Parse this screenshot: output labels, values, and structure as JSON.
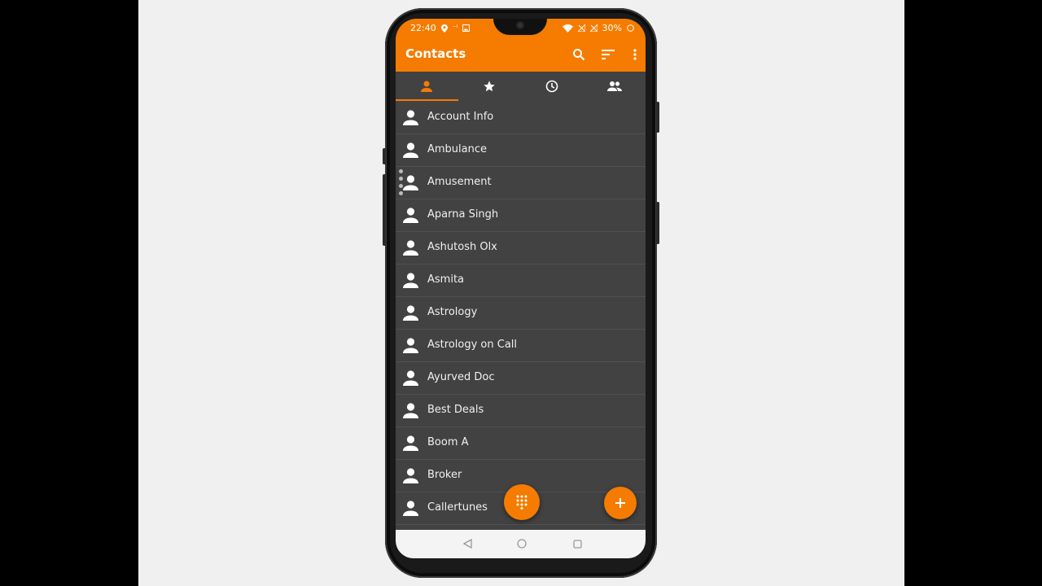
{
  "status_bar": {
    "time": "22:40",
    "carrier_indicator": "⁻ᴵ",
    "battery": "30%",
    "icons_left": [
      "location-icon",
      "signal-small-icon",
      "image-icon"
    ],
    "icons_right": [
      "wifi-icon",
      "no-signal-icon",
      "no-signal-icon",
      "battery-icon"
    ]
  },
  "appbar": {
    "title": "Contacts",
    "actions": [
      "search-icon",
      "sort-icon",
      "more-vert-icon"
    ]
  },
  "tabs": [
    {
      "icon": "person-icon",
      "selected": true
    },
    {
      "icon": "star-icon",
      "selected": false
    },
    {
      "icon": "clock-icon",
      "selected": false
    },
    {
      "icon": "group-icon",
      "selected": false
    }
  ],
  "contacts": [
    "Account Info",
    "Ambulance",
    "Amusement",
    "Aparna Singh",
    "Ashutosh Olx",
    "Asmita",
    "Astrology",
    "Astrology on Call",
    "Ayurved Doc",
    "Best Deals",
    "Boom A",
    "Broker",
    "Callertunes"
  ],
  "fabs": {
    "dialpad": "dialpad-icon",
    "add": "add-icon"
  },
  "navigation": [
    "back-icon",
    "home-icon",
    "recents-icon"
  ],
  "colors": {
    "accent": "#f57c00",
    "background": "#424242",
    "divider": "#505050",
    "text": "#f0f0f0"
  }
}
